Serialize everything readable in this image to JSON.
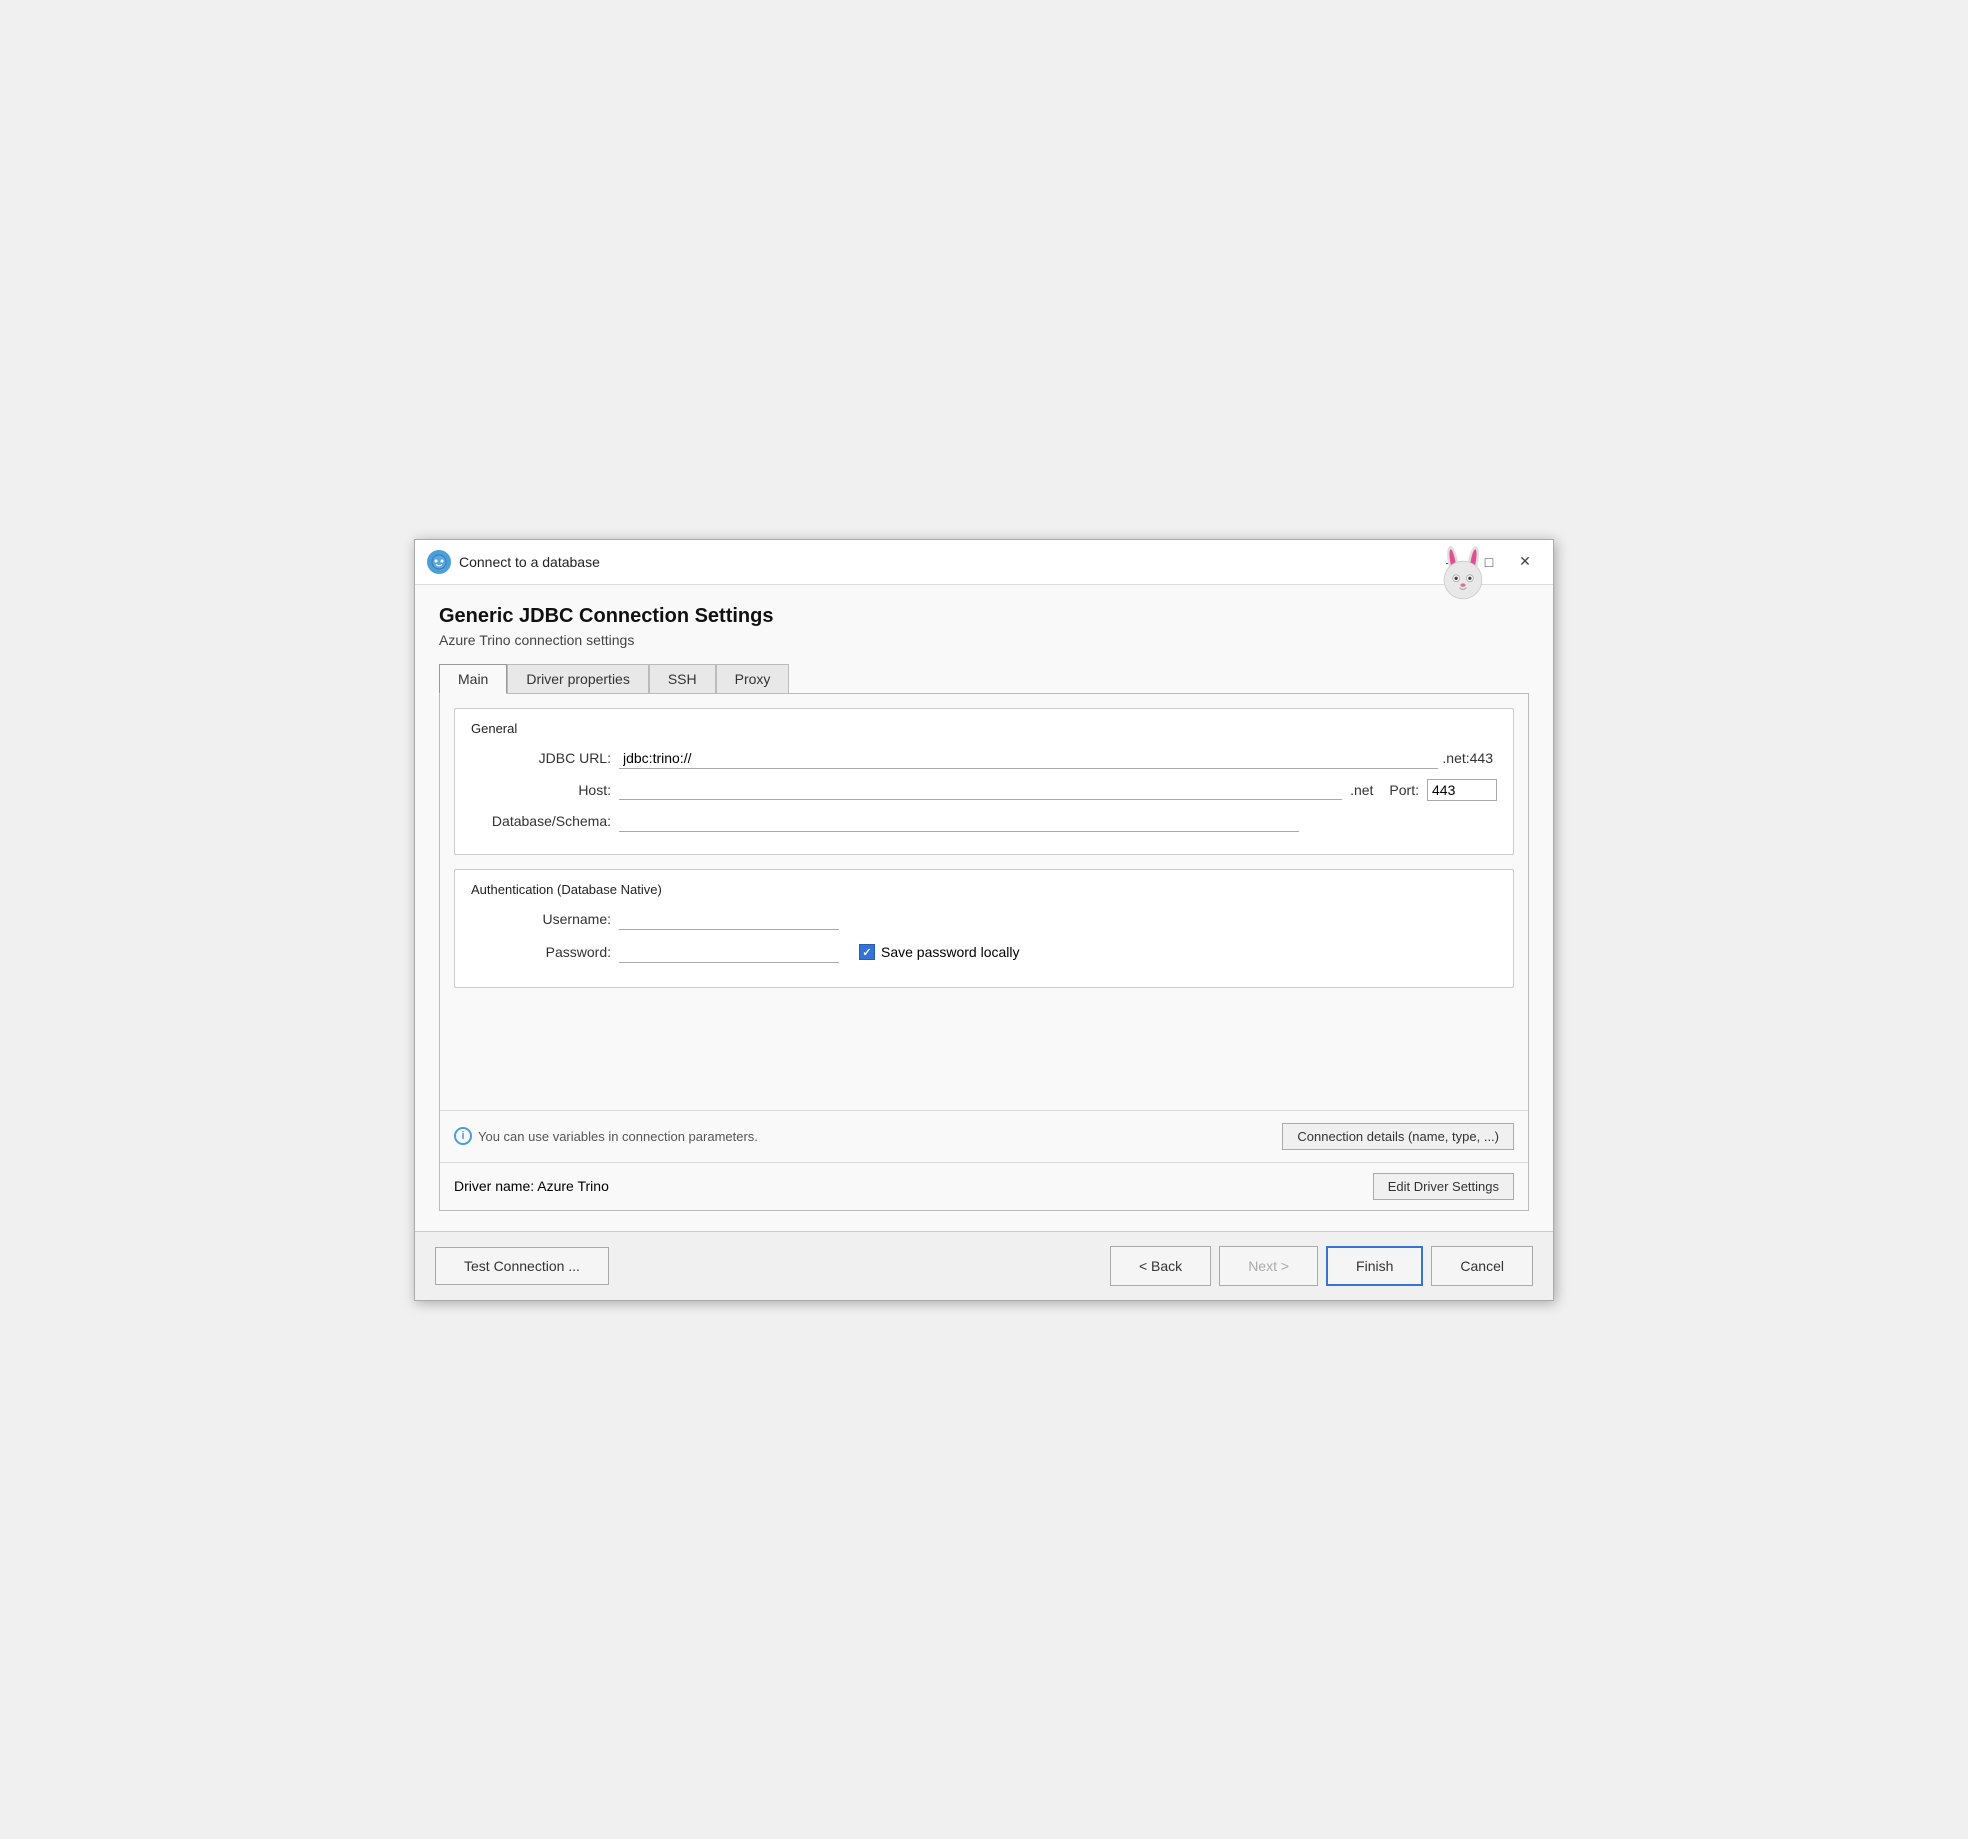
{
  "window": {
    "title": "Connect to a database",
    "minimize_label": "minimize",
    "maximize_label": "maximize",
    "close_label": "close"
  },
  "header": {
    "page_title": "Generic JDBC Connection Settings",
    "page_subtitle": "Azure Trino connection settings"
  },
  "tabs": [
    {
      "id": "main",
      "label": "Main",
      "active": true
    },
    {
      "id": "driver-properties",
      "label": "Driver properties",
      "active": false
    },
    {
      "id": "ssh",
      "label": "SSH",
      "active": false
    },
    {
      "id": "proxy",
      "label": "Proxy",
      "active": false
    }
  ],
  "general_section": {
    "title": "General",
    "jdbc_url_label": "JDBC URL:",
    "jdbc_url_value": "jdbc:trino://",
    "jdbc_url_suffix": ".net:443",
    "host_label": "Host:",
    "host_value": "",
    "host_suffix": ".net",
    "port_label": "Port:",
    "port_value": "443",
    "db_schema_label": "Database/Schema:",
    "db_schema_value": ""
  },
  "auth_section": {
    "title": "Authentication (Database Native)",
    "username_label": "Username:",
    "username_value": "",
    "password_label": "Password:",
    "password_value": "",
    "save_password_label": "Save password locally",
    "save_password_checked": true
  },
  "info_bar": {
    "info_text": "You can use variables in connection parameters.",
    "conn_details_btn_label": "Connection details (name, type, ...)"
  },
  "driver_row": {
    "driver_name_label": "Driver name:",
    "driver_name_value": "Azure Trino",
    "edit_driver_btn_label": "Edit Driver Settings"
  },
  "bottom_buttons": {
    "test_connection_label": "Test Connection ...",
    "back_label": "< Back",
    "next_label": "Next >",
    "finish_label": "Finish",
    "cancel_label": "Cancel"
  }
}
